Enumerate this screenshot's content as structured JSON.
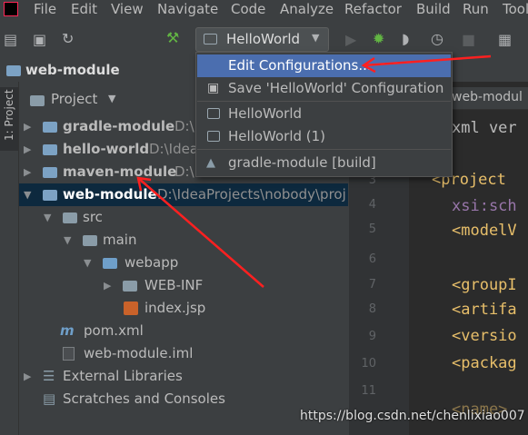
{
  "menubar": {
    "items": [
      "File",
      "Edit",
      "View",
      "Navigate",
      "Code",
      "Analyze",
      "Refactor",
      "Build",
      "Run",
      "Tools"
    ]
  },
  "toolbar": {
    "run_config": "HelloWorld"
  },
  "breadcrumb": {
    "module": "web-module"
  },
  "stripe": {
    "project_tab": "1: Project"
  },
  "project_panel": {
    "header": "Project",
    "rows": [
      {
        "name": "gradle-module",
        "path": "D:\\Idea"
      },
      {
        "name": "hello-world",
        "path": "D:\\Idea"
      },
      {
        "name": "maven-module",
        "path": "D:\\Idea"
      },
      {
        "name": "web-module",
        "path": "D:\\IdeaProjects\\nobody\\proj"
      },
      {
        "name": "src"
      },
      {
        "name": "main"
      },
      {
        "name": "webapp"
      },
      {
        "name": "WEB-INF"
      },
      {
        "name": "index.jsp"
      },
      {
        "name": "pom.xml"
      },
      {
        "name": "web-module.iml"
      },
      {
        "name": "External Libraries"
      },
      {
        "name": "Scratches and Consoles"
      }
    ]
  },
  "editor": {
    "tab": "web-modul",
    "line_numbers": [
      "3",
      "4",
      "5",
      "6",
      "7",
      "8",
      "9",
      "10",
      "11"
    ],
    "lines": [
      "xml ver",
      "<project",
      "xsi:sch",
      "<modelV",
      "<groupI",
      "<artifa",
      "<versio",
      "<packag",
      "<name>"
    ]
  },
  "run_dropdown": {
    "items": [
      {
        "label": "Edit Configurations...",
        "highlighted": true
      },
      {
        "label": "Save 'HelloWorld' Configuration"
      },
      {
        "label": "HelloWorld"
      },
      {
        "label": "HelloWorld (1)"
      },
      {
        "label": "gradle-module [build]"
      }
    ]
  },
  "watermark": "https://blog.csdn.net/chenlixiao007",
  "colors": {
    "accent": "#4b6eaf",
    "annotation": "#ff2020",
    "selection": "#0d293e"
  }
}
